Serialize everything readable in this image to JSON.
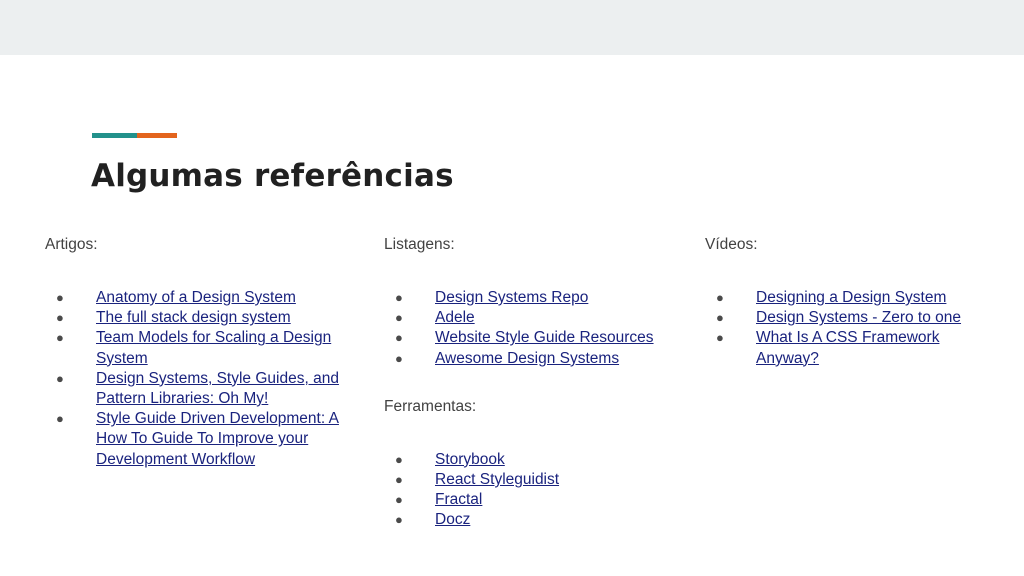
{
  "slide": {
    "title": "Algumas referências",
    "accent_colors": [
      "#22918b",
      "#e3641d"
    ]
  },
  "artigos": {
    "heading": "Artigos:",
    "items": [
      "Anatomy of a Design System",
      "The full stack design system",
      "Team Models for Scaling a Design System",
      "Design Systems, Style Guides, and Pattern Libraries: Oh My!",
      "Style Guide Driven Development: A How To Guide To Improve your Development Workflow"
    ]
  },
  "listagens": {
    "heading": "Listagens:",
    "items": [
      "Design Systems Repo",
      "Adele",
      "Website Style Guide Resources",
      "Awesome Design Systems"
    ]
  },
  "ferramentas": {
    "heading": "Ferramentas:",
    "items": [
      "Storybook",
      "React Styleguidist",
      "Fractal",
      "Docz"
    ]
  },
  "videos": {
    "heading": "Vídeos:",
    "items": [
      "Designing a Design System",
      "Design Systems - Zero to one",
      "What Is A CSS Framework Anyway?"
    ]
  },
  "bullet_glyph": "●"
}
